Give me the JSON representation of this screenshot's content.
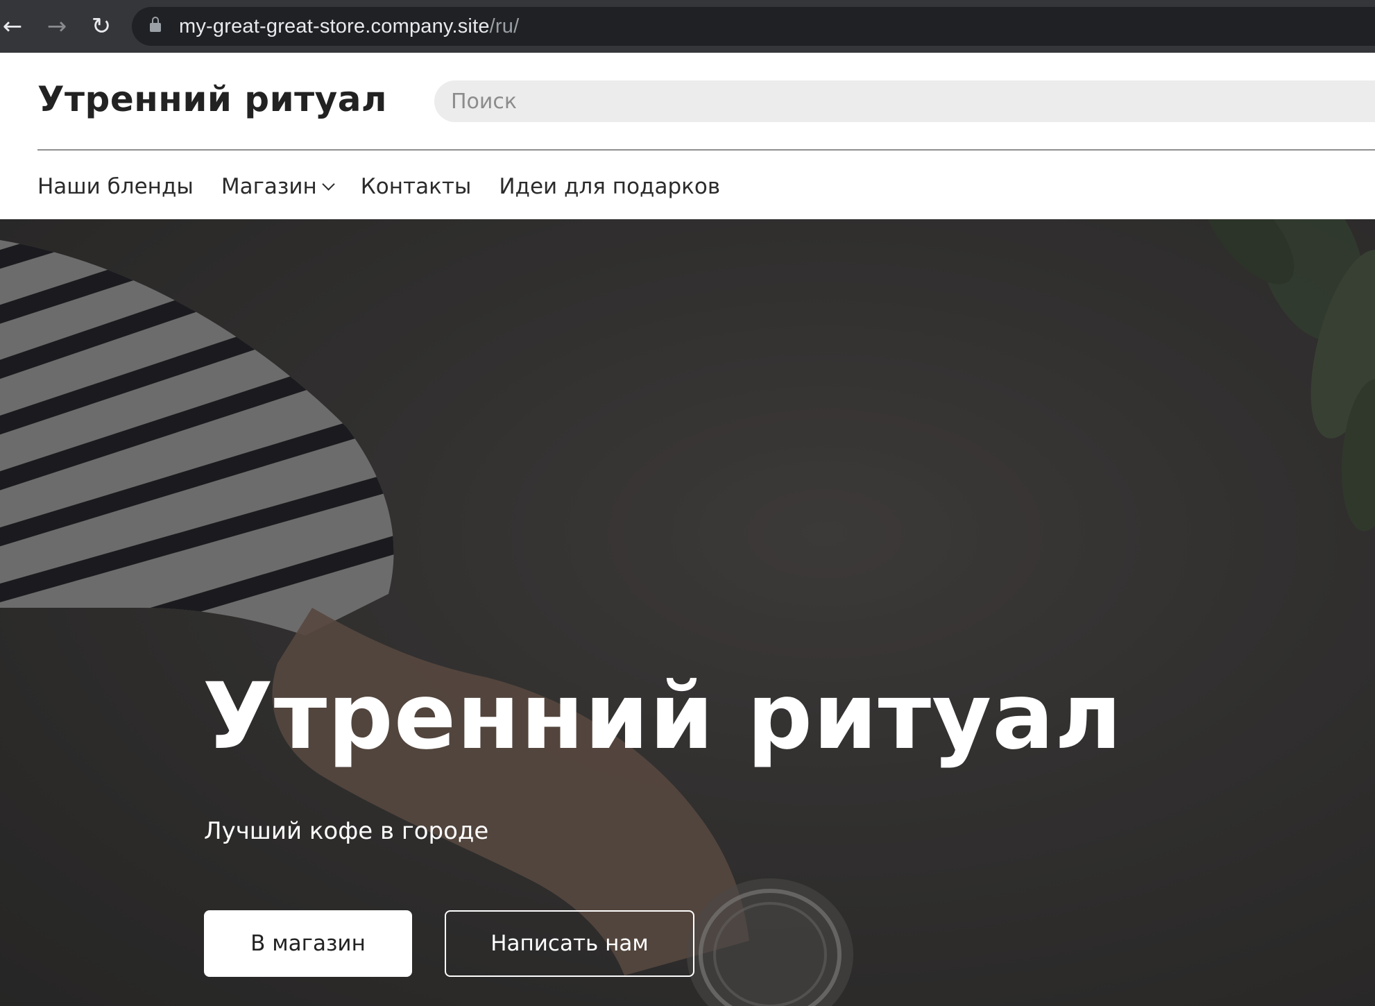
{
  "browser": {
    "back_icon": "←",
    "forward_icon": "→",
    "reload_icon": "↻",
    "url_host": "my-great-great-store.company.site",
    "url_path": "/ru/"
  },
  "header": {
    "logo": "Утренний ритуал",
    "search_placeholder": "Поиск"
  },
  "nav": {
    "items": [
      {
        "label": "Наши бленды"
      },
      {
        "label": "Магазин",
        "has_dropdown": true
      },
      {
        "label": "Контакты"
      },
      {
        "label": "Идеи для подарков"
      }
    ]
  },
  "hero": {
    "title": "Утренний ритуал",
    "subtitle": "Лучший кофе в городе",
    "primary_button": "В магазин",
    "secondary_button": "Написать нам"
  },
  "colors": {
    "browser_chrome": "#35363a",
    "omnibox": "#202124",
    "text_dark": "#222222",
    "search_bg": "#ececec",
    "hero_overlay": "#3a3837",
    "white": "#ffffff"
  }
}
